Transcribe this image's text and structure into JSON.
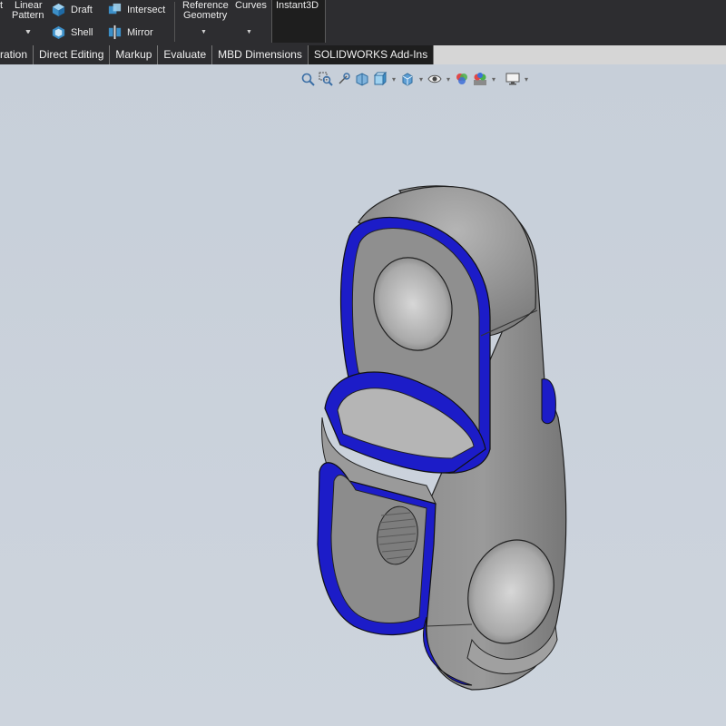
{
  "ribbon": {
    "linear_pattern_label_1": "Linear",
    "linear_pattern_label_2": "Pattern",
    "draft_label": "Draft",
    "shell_label": "Shell",
    "intersect_label": "Intersect",
    "mirror_label": "Mirror",
    "reference_geometry_label_1": "Reference",
    "reference_geometry_label_2": "Geometry",
    "curves_label": "Curves",
    "instant3d_label": "Instant3D",
    "left_clipped_label": "t"
  },
  "tabs": [
    {
      "label": "ration"
    },
    {
      "label": "Direct Editing"
    },
    {
      "label": "Markup"
    },
    {
      "label": "Evaluate"
    },
    {
      "label": "MBD Dimensions"
    },
    {
      "label": "SOLIDWORKS Add-Ins"
    }
  ],
  "view_toolbar": {
    "icons": [
      "zoom-to-fit-icon",
      "zoom-to-area-icon",
      "previous-view-icon",
      "section-view-icon",
      "view-orientation-icon",
      "display-style-icon",
      "hide-show-items-icon",
      "edit-appearance-icon",
      "apply-scene-icon",
      "view-settings-icon"
    ]
  },
  "colors": {
    "ribbon_bg": "#2d2d30",
    "viewport_bg": "#c9d1db",
    "part_gray": "#8f8f8f",
    "selected_face_blue": "#1c1cc8"
  }
}
